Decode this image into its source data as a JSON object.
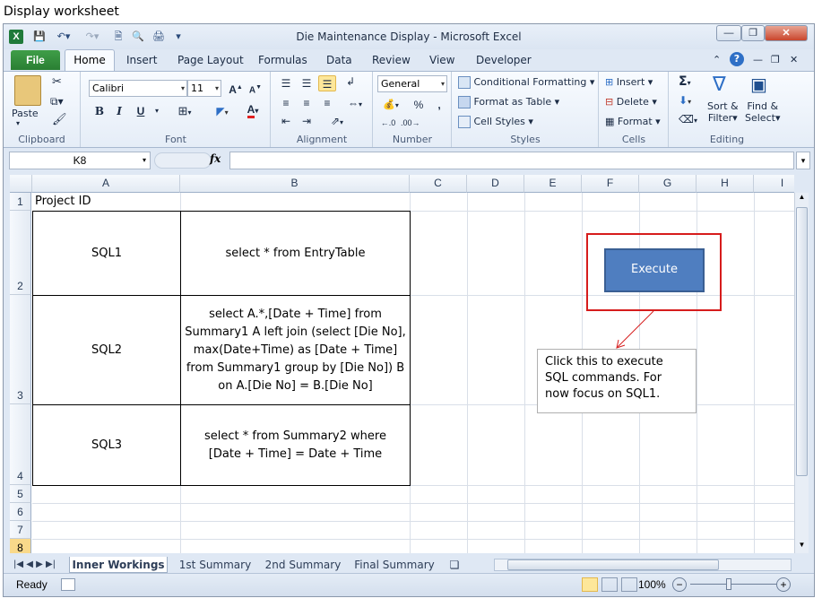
{
  "caption": "Display worksheet",
  "window": {
    "title": "Die Maintenance Display  -  Microsoft Excel"
  },
  "ribbon": {
    "tabs": {
      "file": "File",
      "home": "Home",
      "insert": "Insert",
      "page_layout": "Page Layout",
      "formulas": "Formulas",
      "data": "Data",
      "review": "Review",
      "view": "View",
      "developer": "Developer"
    },
    "clipboard": {
      "label": "Clipboard",
      "paste": "Paste"
    },
    "font": {
      "label": "Font",
      "name": "Calibri",
      "size": "11",
      "bold": "B",
      "italic": "I",
      "underline": "U"
    },
    "alignment": {
      "label": "Alignment"
    },
    "number": {
      "label": "Number",
      "format": "General",
      "percent": "%",
      "comma": ","
    },
    "styles": {
      "label": "Styles",
      "conditional": "Conditional Formatting",
      "format_table": "Format as Table",
      "cell_styles": "Cell Styles"
    },
    "cells": {
      "label": "Cells",
      "insert": "Insert",
      "delete": "Delete",
      "format": "Format"
    },
    "editing": {
      "label": "Editing",
      "sort_1": "Sort &",
      "sort_2": "Filter",
      "find_1": "Find &",
      "find_2": "Select"
    }
  },
  "formula_bar": {
    "name_box": "K8",
    "fx": "fx",
    "value": ""
  },
  "grid": {
    "columns": [
      "A",
      "B",
      "C",
      "D",
      "E",
      "F",
      "G",
      "H",
      "I"
    ],
    "rows": [
      "1",
      "2",
      "3",
      "4",
      "5",
      "6",
      "7",
      "8"
    ],
    "a1": "Project ID",
    "sql1_label": "SQL1",
    "sql1_query": "select * from EntryTable",
    "sql2_label": "SQL2",
    "sql2_query": "select A.*,[Date + Time] from Summary1 A left join (select [Die No], max(Date+Time) as [Date + Time] from Summary1 group by [Die No]) B on A.[Die No] = B.[Die No]",
    "sql3_label": "SQL3",
    "sql3_query": "select * from Summary2 where [Date + Time] = Date + Time"
  },
  "shapes": {
    "execute_button": "Execute",
    "callout_text": "Click this to execute SQL commands. For now focus on SQL1."
  },
  "sheets": [
    "Inner Workings",
    "1st Summary",
    "2nd Summary",
    "Final Summary"
  ],
  "status": {
    "ready": "Ready",
    "zoom": "100%"
  }
}
